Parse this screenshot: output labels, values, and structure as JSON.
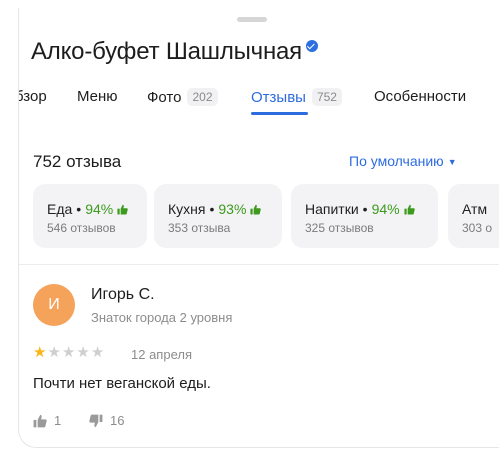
{
  "place": {
    "title": "Алко-буфет Шашлычная",
    "verified_icon": "verified-check-icon"
  },
  "tabs": [
    {
      "label": "бзор",
      "count": ""
    },
    {
      "label": "Меню",
      "count": ""
    },
    {
      "label": "Фото",
      "count": "202"
    },
    {
      "label": "Отзывы",
      "count": "752",
      "active": true
    },
    {
      "label": "Особенности",
      "count": ""
    }
  ],
  "reviews": {
    "count_label": "752 отзыва",
    "sort_label": "По умолчанию",
    "sort_icon": "chevron-down-icon"
  },
  "categories": [
    {
      "name": "Еда",
      "sep": "•",
      "percent": "94%",
      "sub": "546 отзывов"
    },
    {
      "name": "Кухня",
      "sep": "•",
      "percent": "93%",
      "sub": "353 отзыва"
    },
    {
      "name": "Напитки",
      "sep": "•",
      "percent": "94%",
      "sub": "325 отзывов"
    },
    {
      "name": "Атм",
      "sep": "",
      "percent": "",
      "sub": "303 о"
    }
  ],
  "review": {
    "avatar_letter": "И",
    "author": "Игорь С.",
    "level": "Знаток города 2 уровня",
    "rating": 1,
    "rating_max": 5,
    "date": "12 апреля",
    "text": "Почти нет веганской еды.",
    "likes": "1",
    "dislikes": "16"
  },
  "colors": {
    "accent": "#2d6cdf",
    "positive": "#3c9a1d",
    "star": "#f8b61a",
    "avatar": "#f5a25a"
  }
}
